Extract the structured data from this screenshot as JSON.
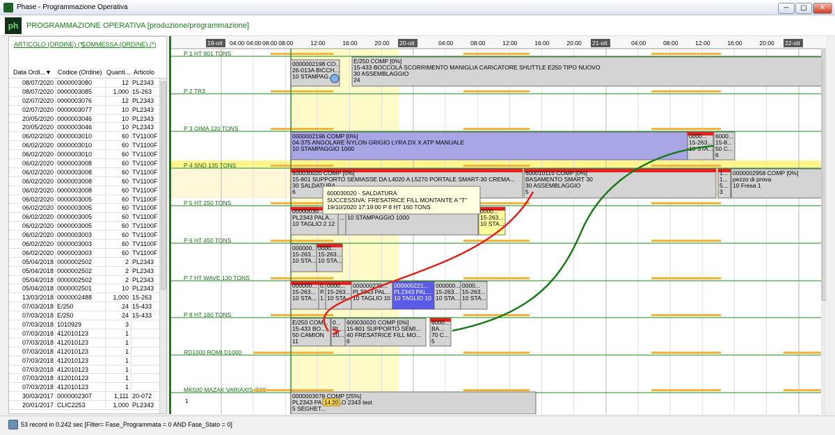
{
  "window": {
    "title": "Phase - Programmazione Operativa",
    "min_label": "─",
    "max_label": "▢",
    "close_label": "✕"
  },
  "header": {
    "logo_text": "ph",
    "title": "PROGRAMMAZIONE OPERATIVA [produzione/programmazione]"
  },
  "filters": {
    "tab1": "ARTICOLO (ORDINE) (*)",
    "tab2": "COMMESSA (ORDINE) (*)"
  },
  "grid": {
    "columns": [
      "Data Ordi...",
      "Codice (Ordine)",
      "Quanti...",
      "Articolo"
    ],
    "rows": [
      [
        "08/07/2020",
        "0000003080",
        "12",
        "PL2343"
      ],
      [
        "08/07/2020",
        "0000003085",
        "1,000",
        "15-263"
      ],
      [
        "02/07/2020",
        "0000003076",
        "12",
        "PL2343"
      ],
      [
        "02/07/2020",
        "0000003077",
        "10",
        "PL2343"
      ],
      [
        "20/05/2020",
        "0000003046",
        "10",
        "PL2343"
      ],
      [
        "20/05/2020",
        "0000003046",
        "10",
        "PL2343"
      ],
      [
        "06/02/2020",
        "0000003010",
        "60",
        "TV1100F"
      ],
      [
        "06/02/2020",
        "0000003010",
        "60",
        "TV1100F"
      ],
      [
        "06/02/2020",
        "0000003010",
        "60",
        "TV1100F"
      ],
      [
        "06/02/2020",
        "0000003008",
        "60",
        "TV1100F"
      ],
      [
        "06/02/2020",
        "0000003008",
        "60",
        "TV1100F"
      ],
      [
        "06/02/2020",
        "0000003008",
        "60",
        "TV1100F"
      ],
      [
        "06/02/2020",
        "0000003008",
        "60",
        "TV1100F"
      ],
      [
        "06/02/2020",
        "0000003005",
        "60",
        "TV1100F"
      ],
      [
        "06/02/2020",
        "0000003005",
        "60",
        "TV1100F"
      ],
      [
        "06/02/2020",
        "0000003005",
        "60",
        "TV1100F"
      ],
      [
        "06/02/2020",
        "0000003005",
        "60",
        "TV1100F"
      ],
      [
        "06/02/2020",
        "0000003003",
        "60",
        "TV1100F"
      ],
      [
        "06/02/2020",
        "0000003003",
        "60",
        "TV1100F"
      ],
      [
        "06/02/2020",
        "0000003003",
        "60",
        "TV1100F"
      ],
      [
        "05/04/2018",
        "0000002502",
        "2",
        "PL2343"
      ],
      [
        "05/04/2018",
        "0000002502",
        "2",
        "PL2343"
      ],
      [
        "05/04/2018",
        "0000002502",
        "2",
        "PL2343"
      ],
      [
        "05/04/2018",
        "0000002501",
        "10",
        "PL2343"
      ],
      [
        "13/03/2018",
        "0000002488",
        "1,000",
        "15-263"
      ],
      [
        "07/03/2018",
        "E/250",
        "24",
        "15-433"
      ],
      [
        "07/03/2018",
        "E/250",
        "24",
        "15-433"
      ],
      [
        "07/03/2018",
        "1010929",
        "3",
        ""
      ],
      [
        "07/03/2018",
        "412010123",
        "1",
        ""
      ],
      [
        "07/03/2018",
        "412010123",
        "1",
        ""
      ],
      [
        "07/03/2018",
        "412010123",
        "1",
        ""
      ],
      [
        "07/03/2018",
        "412010123",
        "1",
        ""
      ],
      [
        "07/03/2018",
        "412010123",
        "1",
        ""
      ],
      [
        "07/03/2018",
        "412010123",
        "1",
        ""
      ],
      [
        "07/03/2018",
        "412010123",
        "1",
        ""
      ],
      [
        "30/03/2017",
        "0000002307",
        "1,111",
        "20-072"
      ],
      [
        "20/01/2017",
        "CLIC2253",
        "1,000",
        "PL2343"
      ]
    ]
  },
  "timeline": {
    "days": [
      "19-ott",
      "20-ott",
      "21-ott",
      "22-ott"
    ],
    "hours": [
      "04:00",
      "08:00",
      "12:00",
      "16:00",
      "20:00"
    ]
  },
  "resources": [
    {
      "name": "P 1 HT 901 TONS"
    },
    {
      "name": "P 2 TR3"
    },
    {
      "name": "P 3 OIMA 120 TONS"
    },
    {
      "name": "P 4 SND 135 TONS"
    },
    {
      "name": "P 5 HT 250 TONS"
    },
    {
      "name": "P 6 HT 450 TONS"
    },
    {
      "name": "P 7 HT WAVE 130 TONS"
    },
    {
      "name": "P 8 HT 160 TONS"
    },
    {
      "name": "RD1000 ROMI D1000"
    },
    {
      "name": "MK500 MAZAK VARIAXIS i500"
    }
  ],
  "tasks": [
    {
      "lines": [
        "0000002198  CO...",
        "26-013A  BICCH...",
        "10  STAMPAG..."
      ]
    },
    {
      "lines": [
        "E/250 COMP [0%]",
        "15-433  BOCCOLA SCORRIMENTO MANIGLIA CARICATORE SHUTTLE E250 TIPO NUOVO",
        "30 ASSEMBLAGGIO",
        "24"
      ]
    },
    {
      "lines": [
        "0000002196 COMP [0%]",
        "04-375  ANGOLARE NYLON GRIGIO LYRA DX X ATP MANUALE",
        "10 STAMPAGGIO 1000"
      ]
    },
    {
      "lines": [
        "0000...",
        "15-263...",
        "10 STA..."
      ]
    },
    {
      "lines": [
        "6000...",
        "15-8...",
        "50 C...",
        "6"
      ]
    },
    {
      "lines": [
        "600030020 COMP [0%]",
        "15-801  SUPPORTO SEMIASSE DA L4020 A L5270 PORTALE SMART-30 CREMA...",
        "30 SALDATURA",
        "6"
      ]
    },
    {
      "lines": [
        "600010115 COMP [0%]",
        "BASAMENTO SMART 30",
        "30 ASSEMBLAGGIO",
        "5"
      ]
    },
    {
      "lines": [
        "1...",
        "1...",
        "5...",
        "3"
      ]
    },
    {
      "lines": [
        "0000002958 COMP [0%]",
        "pezzo di prova",
        "10 Fresa 1"
      ]
    },
    {
      "lines": [
        "00000030...",
        "PL2343  PALA...",
        "10 TAGLIO 2 12"
      ]
    },
    {
      "lines": [
        "P...",
        "..."
      ]
    },
    {
      "lines": [
        "15-263  PART. C SUPP. ASTA SIST. A.I. D.6",
        "10 STAMPAGGIO 1000"
      ]
    },
    {
      "lines": [
        "0000...",
        "15-263...",
        "10 STA..."
      ]
    },
    {
      "lines": [
        "000000...",
        "15-263...",
        "10 STA..."
      ]
    },
    {
      "lines": [
        "0000...",
        "15-263...",
        "10 STA..."
      ]
    },
    {
      "lines": [
        "000000...",
        "15-263...",
        "10 STA..."
      ]
    },
    {
      "lines": [
        "0...",
        "P...",
        "1..."
      ]
    },
    {
      "lines": [
        "0000...",
        "15-263...",
        "10 STA..."
      ]
    },
    {
      "lines": [
        "000000229...",
        "PL2343  PAL...",
        "10 TAGLIO 10"
      ]
    },
    {
      "lines": [
        "000000221...",
        "PL2343  PAL...",
        "10 TAGLIO 10"
      ]
    },
    {
      "lines": [
        "000000...",
        "15-263...",
        "10 STA..."
      ]
    },
    {
      "lines": [
        "0000...",
        "15-263...",
        "10 STA..."
      ]
    },
    {
      "lines": [
        "E/250  COM...",
        "15-433  BO...",
        "50 CAMION",
        "11"
      ]
    },
    {
      "lines": [
        "0...",
        "PL...",
        "20..."
      ]
    },
    {
      "lines": [
        "600030020 COMP [0%]",
        "15-801  SUPPORTO  SEMI...",
        "40 FRESATRICE  FILL MO...",
        "6"
      ]
    },
    {
      "lines": [
        "6000...",
        "BA...",
        "70 C...",
        "5"
      ]
    },
    {
      "lines": [
        "0000003078 COMP [25%]",
        "PL2343  PA...DELLO 2343 test",
        "5 SEGHET..."
      ]
    }
  ],
  "tooltip": {
    "lines": [
      "600030020  -  SALDATURA",
      "SUCCESSIVA: FRESATRICE  FILL MONTANTE A \"T\"",
      "19/10/2020 17:19:00 P 8 HT 160 TONS"
    ]
  },
  "row_count_label": "1",
  "now_marker": "14:20",
  "status": {
    "text": "53 record in 0.242 sec [Filter= Fase_Programmata = 0 AND Fase_Stato = 0]"
  },
  "colors": {
    "task_gray": "#d4d4d4",
    "task_lavender": "#a9a6e6",
    "task_blue": "#5b5bea",
    "task_red": "#e52222",
    "task_yellow": "#ffffa0",
    "row_line": "#1a8a1a",
    "link_red": "#e0201a",
    "link_green": "#1a7a1a",
    "availability": "#f2b43a",
    "highlight": "#fffbc8"
  }
}
